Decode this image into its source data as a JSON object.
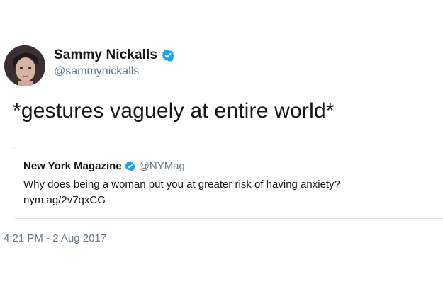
{
  "tweet": {
    "author": {
      "display_name": "Sammy Nickalls",
      "handle": "@sammynickalls",
      "verified": true
    },
    "text": "*gestures vaguely at entire world*",
    "timestamp": "4:21 PM - 2 Aug 2017"
  },
  "quoted_tweet": {
    "display_name": "New York Magazine",
    "handle": "@NYMag",
    "verified": true,
    "text": "Why does being a woman put you at greater risk of having anxiety?",
    "link": "nym.ag/2v7qxCG"
  },
  "icons": {
    "verified": "verified-badge-icon"
  },
  "colors": {
    "verified_blue": "#1da1f2",
    "secondary_text": "#657786",
    "primary_text": "#14171a",
    "card_border": "#e1e8ed"
  }
}
